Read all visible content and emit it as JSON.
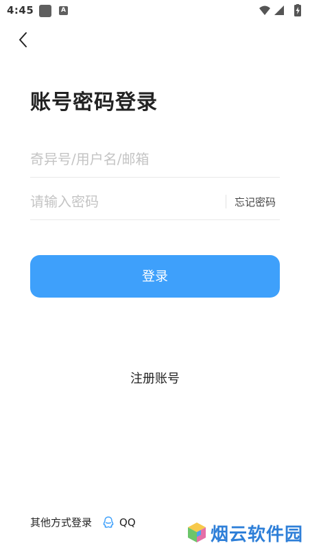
{
  "status_bar": {
    "time": "4:45",
    "notification_a": "A"
  },
  "header": {
    "title": "账号密码登录"
  },
  "form": {
    "account_placeholder": "奇异号/用户名/邮箱",
    "password_placeholder": "请输入密码",
    "forgot_password": "忘记密码",
    "login_label": "登录",
    "register_label": "注册账号"
  },
  "other_login": {
    "label": "其他方式登录",
    "qq_label": "QQ"
  },
  "watermark": {
    "text": "烟云软件园"
  },
  "colors": {
    "primary_button": "#3ea0fb",
    "watermark": "#2e7fd8"
  }
}
